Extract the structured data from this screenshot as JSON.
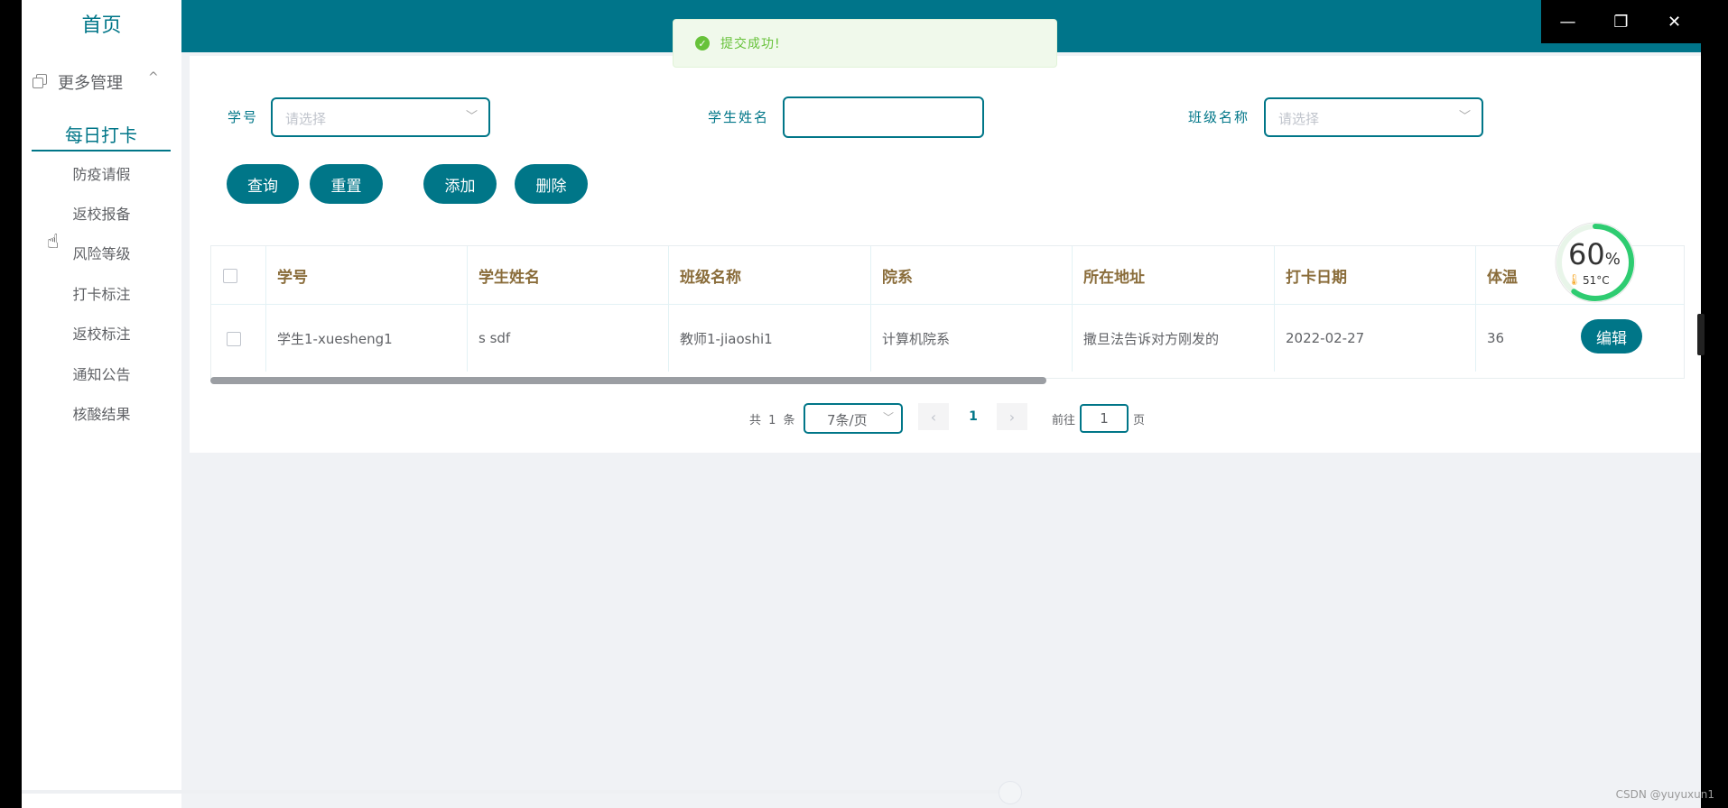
{
  "sidebar": {
    "home": "首页",
    "group_label": "更多管理",
    "group_chevron": "^",
    "items": [
      {
        "label": "每日打卡"
      },
      {
        "label": "防疫请假"
      },
      {
        "label": "返校报备"
      },
      {
        "label": "风险等级"
      },
      {
        "label": "打卡标注"
      },
      {
        "label": "返校标注"
      },
      {
        "label": "通知公告"
      },
      {
        "label": "核酸结果"
      }
    ]
  },
  "toast": {
    "icon": "✓",
    "text": "提交成功!"
  },
  "window_controls": {
    "minimize": "—",
    "restore": "❐",
    "close": "✕"
  },
  "filters": {
    "student_id_label": "学号",
    "student_id_placeholder": "请选择",
    "student_name_label": "学生姓名",
    "class_name_label": "班级名称",
    "class_name_placeholder": "请选择",
    "dropdown_icon": "﹀"
  },
  "buttons": {
    "query": "查询",
    "reset": "重置",
    "add": "添加",
    "delete": "删除"
  },
  "table": {
    "headers": [
      "学号",
      "学生姓名",
      "班级名称",
      "院系",
      "所在地址",
      "打卡日期",
      "体温"
    ],
    "rows": [
      {
        "cells": [
          "学生1-xuesheng1",
          "s sdf",
          "教师1-jiaoshi1",
          "计算机院系",
          "撒旦法告诉对方刚发的",
          "2022-02-27",
          "36"
        ],
        "edit": "编辑"
      }
    ]
  },
  "pagination": {
    "total": "共 1 条",
    "page_size": "7条/页",
    "prev": "‹",
    "current": "1",
    "next": "›",
    "goto_label": "前往",
    "goto_value": "1",
    "page_suffix": "页"
  },
  "gauge": {
    "percent": "60",
    "percent_sign": "%",
    "thermo_icon": "🌡",
    "temp": "51°C",
    "level": 0.6
  },
  "watermark": "CSDN @yuyuxun1",
  "colors": {
    "primary": "#007688",
    "header": "#00758a",
    "success": "#67c23a",
    "gauge": "#2ecc71"
  }
}
